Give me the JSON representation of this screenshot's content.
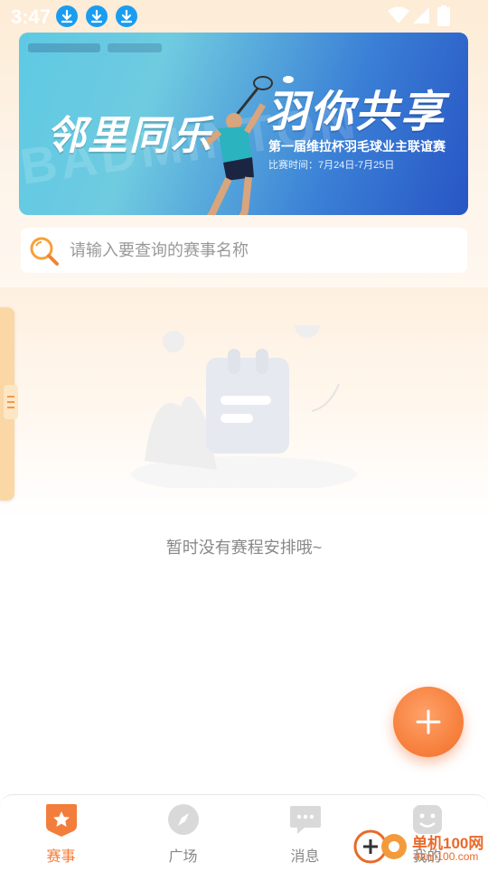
{
  "status_bar": {
    "time": "3:47"
  },
  "banner": {
    "logo_text": "",
    "title_left": "邻里同乐",
    "title_right": "羽你共享",
    "watermark": "BADMINTON",
    "subtitle": "第一届维拉杯羽毛球业主联谊赛",
    "date": "比赛时间：7月24日-7月25日"
  },
  "search": {
    "placeholder": "请输入要查询的赛事名称",
    "value": ""
  },
  "empty_state": {
    "message": "暂时没有赛程安排哦~"
  },
  "bottom_nav": {
    "items": [
      {
        "label": "赛事",
        "icon": "star-badge-icon",
        "active": true
      },
      {
        "label": "广场",
        "icon": "compass-icon",
        "active": false
      },
      {
        "label": "消息",
        "icon": "chat-bubble-icon",
        "active": false
      },
      {
        "label": "我的",
        "icon": "profile-face-icon",
        "active": false
      }
    ]
  },
  "watermark": {
    "brand": "单机100网",
    "url": "danji100.com"
  },
  "colors": {
    "accent": "#f37d3a",
    "nav_inactive": "#888888",
    "download_badge": "#1a9df0"
  }
}
